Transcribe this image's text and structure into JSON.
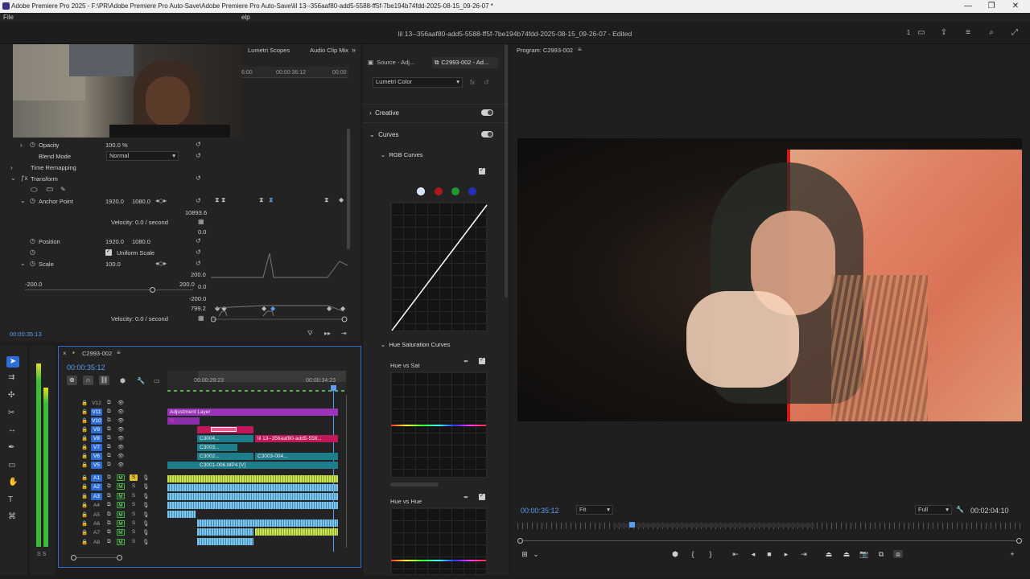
{
  "window": {
    "title": "Adobe Premiere Pro 2025 - F:\\PR\\Adobe Premiere Pro Auto-Save\\Adobe Premiere Pro Auto-Save\\lil 13--356aaf80-add5-5588-ff5f-7be194b74fdd-2025-08-15_09-26-07 *",
    "minimize": "—",
    "restore": "❐",
    "close": "✕"
  },
  "menu": {
    "file": "File",
    "help": "elp"
  },
  "document": {
    "title": "lil 13--356aaf80-add5-5588-ff5f-7be194b74fdd-2025-08-15_09-26-07 - Edited",
    "count": "1"
  },
  "source_panel": {
    "tabs": {
      "lumetri_scopes": "Lumetri Scopes",
      "audio_clip_mixer": "Audio Clip Mix",
      "overflow": "»"
    },
    "ruler": {
      "left": "6:00",
      "mid": "00:00:36:12",
      "right": "00:00"
    }
  },
  "effect_controls": {
    "opacity": {
      "label": "Opacity",
      "value": "100.0 %"
    },
    "blend_mode": {
      "label": "Blend Mode",
      "value": "Normal"
    },
    "time_remapping": {
      "label": "Time Remapping"
    },
    "transform": {
      "label": "Transform"
    },
    "anchor_point": {
      "label": "Anchor Point",
      "x": "1920.0",
      "y": "1080.0"
    },
    "graph_top": "10893.6",
    "graph_zero": "0.0",
    "velocity1": "Velocity: 0.0 / second",
    "position": {
      "label": "Position",
      "x": "1920.0",
      "y": "1080.0"
    },
    "uniform_scale": {
      "label": "Uniform Scale"
    },
    "scale": {
      "label": "Scale",
      "value": "100.0"
    },
    "scale_range": {
      "min": "-200.0",
      "max": "200.0"
    },
    "scale_graph": {
      "top": "200.0",
      "zero": "0.0",
      "neg": "-200.0",
      "vel": "799.2"
    },
    "velocity2": "Velocity: 0.0 / second",
    "timecode": "00:00:35:13"
  },
  "lumetri": {
    "tabs": {
      "source": "Source - Adj...",
      "sequence": "C2993-002 - Ad..."
    },
    "effect_select": "Lumetri Color",
    "fx": "fx",
    "sections": {
      "creative": "Creative",
      "curves": "Curves",
      "rgb_curves": "RGB Curves",
      "hue_sat_curves": "Hue Saturation Curves",
      "hue_vs_sat": "Hue vs Sat",
      "hue_vs_hue": "Hue vs Hue"
    },
    "channel_colors": [
      "#cfe3ff",
      "#b01818",
      "#1c9a2a",
      "#2430b8"
    ]
  },
  "program": {
    "title": "Program: C2993-002",
    "timecode": "00:00:35:12",
    "fit": "Fit",
    "quality": "Full",
    "duration": "00:02:04:10"
  },
  "timeline": {
    "sequence": "C2993-002",
    "timecode": "00:00:35:12",
    "ruler": {
      "t1": "00:00:29:23",
      "t2": "00:00:34:23"
    },
    "video_tracks": [
      "V12",
      "V11",
      "V10",
      "V9",
      "V8",
      "V7",
      "V6",
      "V5"
    ],
    "audio_tracks": [
      "A1",
      "A2",
      "A3",
      "A4",
      "A5",
      "A6",
      "A7",
      "A8"
    ],
    "clips": {
      "adjustment_layer": "Adjustment Layer",
      "lil13": "lil 13--356aaf80-add5-558...",
      "c3004": "C3004...",
      "c3003": "C3003...",
      "c3002": "C3002...",
      "c3003_004": "C3003-004...",
      "c3001": "C3001-006.MP4 [V]"
    },
    "mute": "M",
    "solo": "S"
  },
  "meters": {
    "labels": "S S"
  },
  "colors": {
    "accent": "#2d6dd6",
    "timecode": "#5a9cf0",
    "adjustment": "#8a2fa8",
    "nested": "#c2185b",
    "video_clip": "#1e7e8c",
    "audio": "#6fbfe8"
  }
}
